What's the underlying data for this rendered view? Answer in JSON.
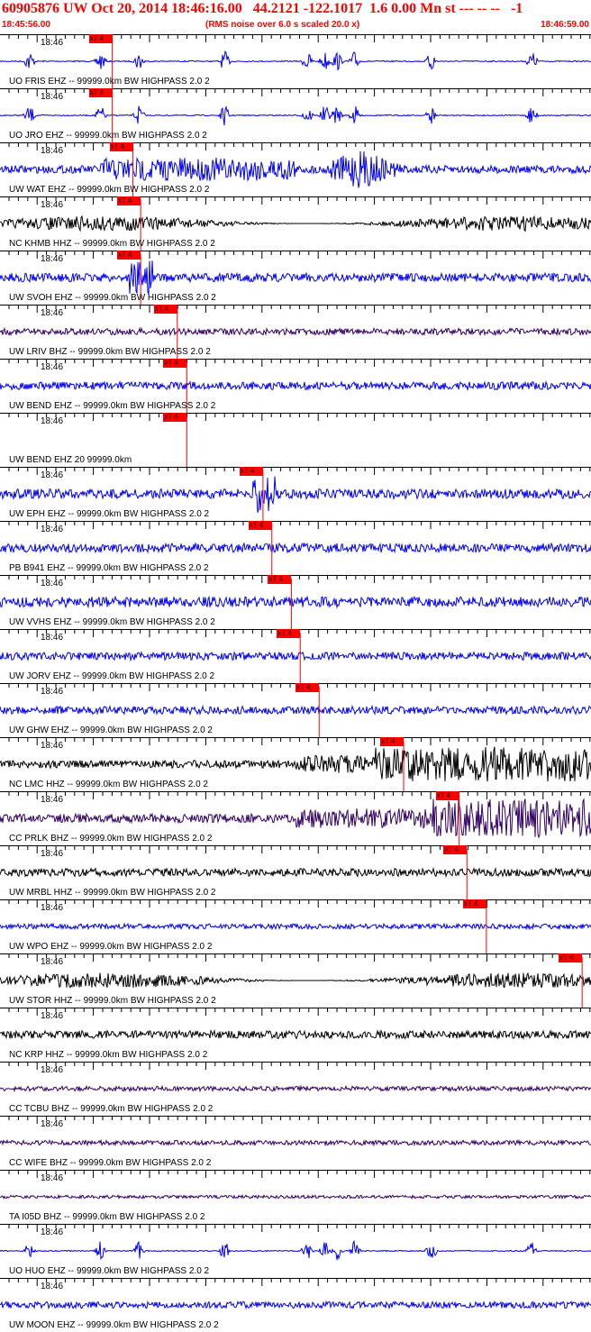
{
  "header": {
    "title": "60905876 UW Oct 20, 2014 18:46:16.00   44.2121 -122.1017  1.6 0.00 Mn st --- -- --   -1",
    "start_time": "18:45:56.00",
    "note": "(RMS noise over 6.0 s scaled 20.0 x)",
    "end_time": "18:46:59.00"
  },
  "trace_time_label": "18:46",
  "pick_label": "xT 4",
  "colors": {
    "red": "#ff0000",
    "blue": "#0000ff",
    "black": "#000000",
    "purple": "#330066"
  },
  "traces": [
    {
      "label": "UO FRIS EHZ -- 99999.0km BW  HIGHPASS  2.0  2",
      "color": "blue",
      "pick": 0.19,
      "kind": "bursts",
      "amp": 0.5
    },
    {
      "label": "UO JRO EHZ -- 99999.0km BW  HIGHPASS  2.0  2",
      "color": "blue",
      "pick": 0.19,
      "kind": "bursts",
      "amp": 0.5
    },
    {
      "label": "UW WAT EHZ -- 99999.0km BW  HIGHPASS  2.0  2",
      "color": "blue",
      "pick": 0.225,
      "kind": "quake2",
      "amp": 0.9
    },
    {
      "label": "NC KHMB HHZ -- 99999.0km BW  HIGHPASS  2.0  2",
      "color": "black",
      "pick": 0.238,
      "kind": "envelope",
      "amp": 0.35
    },
    {
      "label": "UW SVOH EHZ -- 99999.0km BW  HIGHPASS  2.0  2",
      "color": "blue",
      "pick": 0.238,
      "kind": "spike",
      "amp": 0.8
    },
    {
      "label": "UW LRIV BHZ -- 99999.0km BW  HIGHPASS  2.0  2",
      "color": "purple",
      "pick": 0.3,
      "kind": "quiet",
      "amp": 0.25
    },
    {
      "label": "UW BEND EHZ -- 99999.0km BW  HIGHPASS  2.0  2",
      "color": "blue",
      "pick": 0.316,
      "kind": "noise",
      "amp": 0.3
    },
    {
      "label": "UW BEND EHZ 20 99999.0km",
      "color": "none",
      "pick": 0.316,
      "kind": "none",
      "amp": 0
    },
    {
      "label": "UW EPH EHZ -- 99999.0km BW  HIGHPASS  2.0  2",
      "color": "blue",
      "pick": 0.445,
      "kind": "spike",
      "amp": 0.9
    },
    {
      "label": "PB B941 EHZ -- 99999.0km BW  HIGHPASS  2.0  2",
      "color": "blue",
      "pick": 0.46,
      "kind": "noise",
      "amp": 0.35
    },
    {
      "label": "UW VVHS EHZ -- 99999.0km BW  HIGHPASS  2.0  2",
      "color": "blue",
      "pick": 0.493,
      "kind": "noise",
      "amp": 0.4
    },
    {
      "label": "UW JORV EHZ -- 99999.0km BW  HIGHPASS  2.0  2",
      "color": "blue",
      "pick": 0.508,
      "kind": "noise",
      "amp": 0.3
    },
    {
      "label": "UW GHW EHZ -- 99999.0km BW  HIGHPASS  2.0  2",
      "color": "blue",
      "pick": 0.54,
      "kind": "noise",
      "amp": 0.3
    },
    {
      "label": "NC LMC HHZ -- 99999.0km BW  HIGHPASS  2.0  2",
      "color": "black",
      "pick": 0.683,
      "kind": "late",
      "amp": 0.9
    },
    {
      "label": "CC PRLK BHZ -- 99999.0km BW  HIGHPASS  2.0  2",
      "color": "purple",
      "pick": 0.777,
      "kind": "late",
      "amp": 1.0
    },
    {
      "label": "UW MRBL HHZ -- 99999.0km BW  HIGHPASS  2.0  2",
      "color": "black",
      "pick": 0.79,
      "kind": "noise",
      "amp": 0.3
    },
    {
      "label": "UW WPO EHZ -- 99999.0km BW  HIGHPASS  2.0  2",
      "color": "blue",
      "pick": 0.823,
      "kind": "quiet",
      "amp": 0.2
    },
    {
      "label": "UW STOR HHZ -- 99999.0km BW  HIGHPASS  2.0  2",
      "color": "black",
      "pick": 0.985,
      "kind": "envelope",
      "amp": 0.35
    },
    {
      "label": "NC KRP HHZ -- 99999.0km BW  HIGHPASS  2.0  2",
      "color": "black",
      "pick": null,
      "kind": "noise",
      "amp": 0.3
    },
    {
      "label": "CC TCBU BHZ -- 99999.0km BW  HIGHPASS  2.0  2",
      "color": "purple",
      "pick": null,
      "kind": "quiet",
      "amp": 0.18
    },
    {
      "label": "CC WIFE BHZ -- 99999.0km BW  HIGHPASS  2.0  2",
      "color": "purple",
      "pick": null,
      "kind": "quiet",
      "amp": 0.18
    },
    {
      "label": "TA I05D BHZ -- 99999.0km BW  HIGHPASS  2.0  2",
      "color": "purple",
      "pick": null,
      "kind": "quiet",
      "amp": 0.12
    },
    {
      "label": "UO HUO EHZ -- 99999.0km BW  HIGHPASS  2.0  2",
      "color": "blue",
      "pick": null,
      "kind": "bursts",
      "amp": 0.5
    },
    {
      "label": "UW MOON EHZ -- 99999.0km BW  HIGHPASS  2.0  2",
      "color": "blue",
      "pick": null,
      "kind": "noise",
      "amp": 0.25
    }
  ]
}
